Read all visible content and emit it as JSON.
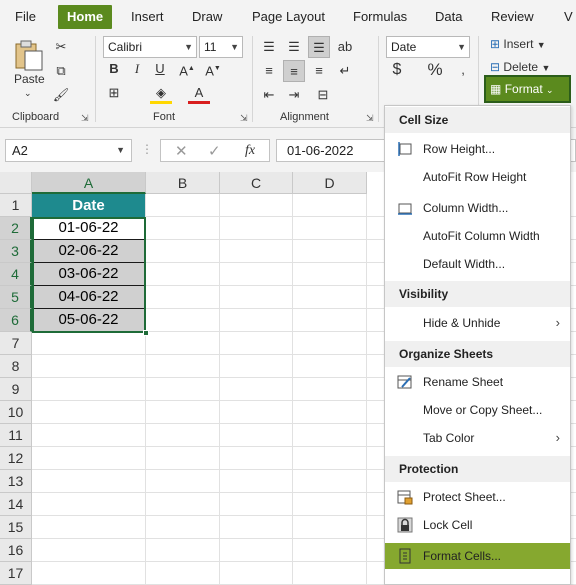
{
  "tabs": [
    {
      "label": "File",
      "active": false
    },
    {
      "label": "Home",
      "active": true
    },
    {
      "label": "Insert",
      "active": false
    },
    {
      "label": "Draw",
      "active": false
    },
    {
      "label": "Page Layout",
      "active": false
    },
    {
      "label": "Formulas",
      "active": false
    },
    {
      "label": "Data",
      "active": false
    },
    {
      "label": "Review",
      "active": false
    },
    {
      "label": "V",
      "active": false
    }
  ],
  "ribbon": {
    "clipboard": {
      "paste_label": "Paste",
      "group_label": "Clipboard"
    },
    "font": {
      "font_name": "Calibri",
      "font_size": "11",
      "group_label": "Font"
    },
    "alignment": {
      "group_label": "Alignment"
    },
    "number": {
      "format": "Date",
      "currency": "$",
      "percent": "%"
    },
    "cells": {
      "insert_label": "Insert",
      "delete_label": "Delete",
      "format_label": "Format"
    }
  },
  "formula_bar": {
    "name_box": "A2",
    "fx": "fx",
    "value": "01-06-2022"
  },
  "grid": {
    "columns": [
      "A",
      "B",
      "C",
      "D"
    ],
    "rows": [
      "1",
      "2",
      "3",
      "4",
      "5",
      "6",
      "7",
      "8",
      "9",
      "10",
      "11",
      "12",
      "13",
      "14",
      "15",
      "16",
      "17"
    ],
    "cells": {
      "header": "Date",
      "values": [
        "01-06-22",
        "02-06-22",
        "03-06-22",
        "04-06-22",
        "05-06-22"
      ]
    }
  },
  "format_menu": {
    "cell_size": {
      "title": "Cell Size",
      "items": [
        "Row Height...",
        "AutoFit Row Height",
        "Column Width...",
        "AutoFit Column Width",
        "Default Width..."
      ]
    },
    "visibility": {
      "title": "Visibility",
      "items": [
        "Hide & Unhide"
      ]
    },
    "organize": {
      "title": "Organize Sheets",
      "items": [
        "Rename Sheet",
        "Move or Copy Sheet...",
        "Tab Color"
      ]
    },
    "protection": {
      "title": "Protection",
      "items": [
        "Protect Sheet...",
        "Lock Cell",
        "Format Cells..."
      ]
    }
  },
  "colors": {
    "accent": "#5b8a1e",
    "header_fill": "#1e8a8e",
    "selection": "#1e6b38",
    "menu_highlight": "#86a82f"
  }
}
